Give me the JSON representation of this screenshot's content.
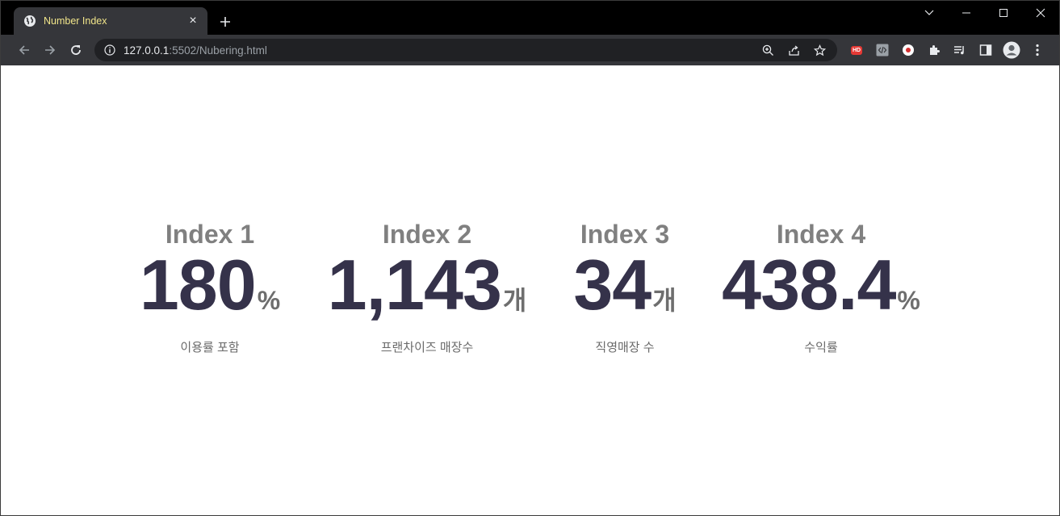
{
  "browser": {
    "tab": {
      "title": "Number Index",
      "close_icon": "×"
    },
    "url": {
      "host": "127.0.0.1",
      "rest": ":5502/Nubering.html"
    },
    "extension_badge": "HD"
  },
  "stats": [
    {
      "title": "Index 1",
      "value": "180",
      "unit": "%",
      "desc": "이용률 포함"
    },
    {
      "title": "Index 2",
      "value": "1,143",
      "unit": "개",
      "desc": "프랜차이즈 매장수"
    },
    {
      "title": "Index 3",
      "value": "34",
      "unit": "개",
      "desc": "직영매장 수"
    },
    {
      "title": "Index 4",
      "value": "438.4",
      "unit": "%",
      "desc": "수익률"
    }
  ],
  "colors": {
    "tab_bg": "#35363a",
    "tab_title": "#f1e58a",
    "value": "#35324a",
    "title": "#808080"
  }
}
